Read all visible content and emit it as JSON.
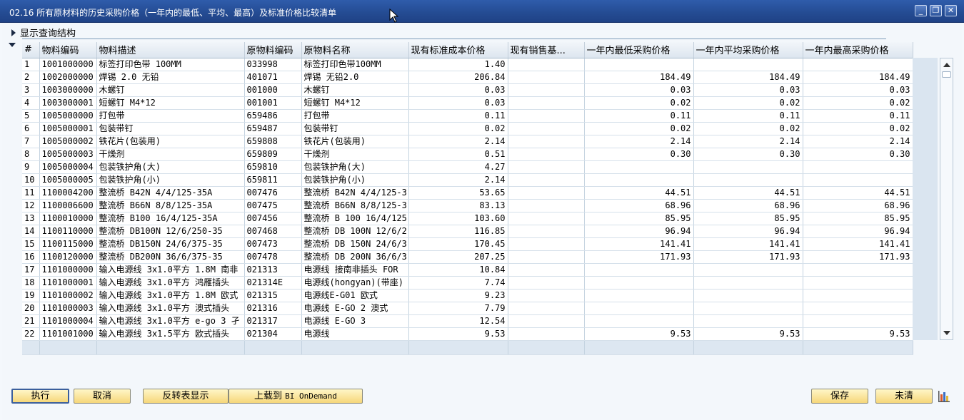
{
  "window": {
    "title": "02.16 所有原材料的历史采购价格（一年内的最低、平均、最高）及标准价格比较清单",
    "minimize_glyph": "_",
    "restore_glyph": "❐",
    "close_glyph": "✕"
  },
  "query": {
    "label": "显示查询结构"
  },
  "table": {
    "columns": [
      "#",
      "物料编码",
      "物料描述",
      "原物料编码",
      "原物料名称",
      "现有标准成本价格",
      "现有销售基...",
      "一年内最低采购价格",
      "一年内平均采购价格",
      "一年内最高采购价格"
    ],
    "rows": [
      [
        "1",
        "1001000000",
        "标签打印色带 100MM",
        "033998",
        "标签打印色带100MM",
        "1.40",
        "",
        "",
        "",
        ""
      ],
      [
        "2",
        "1002000000",
        "焊锡 2.0 无铅",
        "401071",
        "焊锡 无铅2.0",
        "206.84",
        "",
        "184.49",
        "184.49",
        "184.49"
      ],
      [
        "3",
        "1003000000",
        "木螺钉",
        "001000",
        "木螺钉",
        "0.03",
        "",
        "0.03",
        "0.03",
        "0.03"
      ],
      [
        "4",
        "1003000001",
        "短螺钉 M4*12",
        "001001",
        "短螺钉 M4*12",
        "0.03",
        "",
        "0.02",
        "0.02",
        "0.02"
      ],
      [
        "5",
        "1005000000",
        "打包带",
        "659486",
        "打包带",
        "0.11",
        "",
        "0.11",
        "0.11",
        "0.11"
      ],
      [
        "6",
        "1005000001",
        "包装带钉",
        "659487",
        "包装带钉",
        "0.02",
        "",
        "0.02",
        "0.02",
        "0.02"
      ],
      [
        "7",
        "1005000002",
        "铁花片(包装用)",
        "659808",
        "铁花片(包装用)",
        "2.14",
        "",
        "2.14",
        "2.14",
        "2.14"
      ],
      [
        "8",
        "1005000003",
        "干燥剂",
        "659809",
        "干燥剂",
        "0.51",
        "",
        "0.30",
        "0.30",
        "0.30"
      ],
      [
        "9",
        "1005000004",
        "包装铁护角(大)",
        "659810",
        "包装铁护角(大)",
        "4.27",
        "",
        "",
        "",
        ""
      ],
      [
        "10",
        "1005000005",
        "包装铁护角(小)",
        "659811",
        "包装铁护角(小)",
        "2.14",
        "",
        "",
        "",
        ""
      ],
      [
        "11",
        "1100004200",
        "整流桥 B42N 4/4/125-35A",
        "007476",
        "整流桥 B42N 4/4/125-3",
        "53.65",
        "",
        "44.51",
        "44.51",
        "44.51"
      ],
      [
        "12",
        "1100006600",
        "整流桥 B66N 8/8/125-35A",
        "007475",
        "整流桥 B66N 8/8/125-3",
        "83.13",
        "",
        "68.96",
        "68.96",
        "68.96"
      ],
      [
        "13",
        "1100010000",
        "整流桥 B100 16/4/125-35A",
        "007456",
        "整流桥 B 100 16/4/125",
        "103.60",
        "",
        "85.95",
        "85.95",
        "85.95"
      ],
      [
        "14",
        "1100110000",
        "整流桥 DB100N 12/6/250-35",
        "007468",
        "整流桥 DB 100N 12/6/2",
        "116.85",
        "",
        "96.94",
        "96.94",
        "96.94"
      ],
      [
        "15",
        "1100115000",
        "整流桥 DB150N 24/6/375-35",
        "007473",
        "整流桥 DB 150N 24/6/3",
        "170.45",
        "",
        "141.41",
        "141.41",
        "141.41"
      ],
      [
        "16",
        "1100120000",
        "整流桥 DB200N 36/6/375-35",
        "007478",
        "整流桥 DB 200N 36/6/3",
        "207.25",
        "",
        "171.93",
        "171.93",
        "171.93"
      ],
      [
        "17",
        "1101000000",
        "输入电源线 3x1.0平方 1.8M 南非",
        "021313",
        "电源线 接南非插头 FOR",
        "10.84",
        "",
        "",
        "",
        ""
      ],
      [
        "18",
        "1101000001",
        "输入电源线 3x1.0平方 鸿雁插头",
        "021314E",
        "电源线(hongyan)(带座)",
        "7.74",
        "",
        "",
        "",
        ""
      ],
      [
        "19",
        "1101000002",
        "输入电源线 3x1.0平方 1.8M 欧式",
        "021315",
        "电源线E-G01 欧式",
        "9.23",
        "",
        "",
        "",
        ""
      ],
      [
        "20",
        "1101000003",
        "输入电源线 3x1.0平方 澳式插头",
        "021316",
        "电源线 E-GO 2 澳式",
        "7.79",
        "",
        "",
        "",
        ""
      ],
      [
        "21",
        "1101000004",
        "输入电源线 3x1.0平方 e-go 3 孑",
        "021317",
        "电源线 E-GO 3",
        "12.54",
        "",
        "",
        "",
        ""
      ],
      [
        "22",
        "1101001000",
        "输入电源线 3x1.5平方 欧式插头",
        "021304",
        "电源线",
        "9.53",
        "",
        "9.53",
        "9.53",
        "9.53"
      ]
    ]
  },
  "buttons": {
    "execute": "执行",
    "cancel": "取消",
    "pivot": "反转表显示",
    "upload_prefix": "上载到 ",
    "upload_suffix": "BI OnDemand",
    "save": "保存",
    "clear": "未清"
  }
}
